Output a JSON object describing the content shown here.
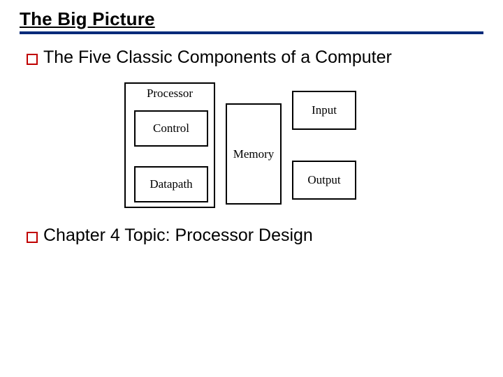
{
  "title": "The Big Picture",
  "bullets": {
    "b1": "The Five Classic Components of a Computer",
    "b2": "Chapter 4 Topic: Processor Design"
  },
  "diagram": {
    "processor": "Processor",
    "control": "Control",
    "datapath": "Datapath",
    "memory": "Memory",
    "input": "Input",
    "output": "Output"
  }
}
